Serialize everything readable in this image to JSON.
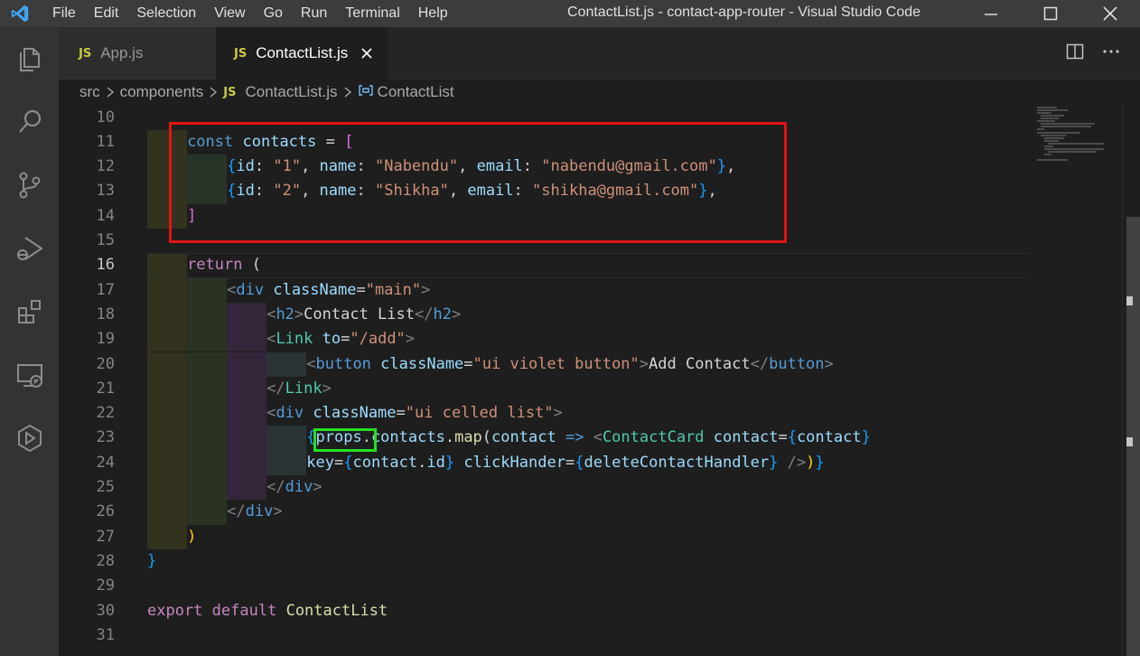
{
  "menu": [
    "File",
    "Edit",
    "Selection",
    "View",
    "Go",
    "Run",
    "Terminal",
    "Help"
  ],
  "window_title": "ContactList.js - contact-app-router - Visual Studio Code",
  "tabs": [
    {
      "badge": "JS",
      "label": "App.js",
      "active": false
    },
    {
      "badge": "JS",
      "label": "ContactList.js",
      "active": true
    }
  ],
  "breadcrumb": {
    "folder1": "src",
    "folder2": "components",
    "file_badge": "JS",
    "file": "ContactList.js",
    "symbol": "ContactList"
  },
  "colors": {
    "annotation_red": "#e11414",
    "annotation_green": "#25e025",
    "editor_bg": "#1e1e1e"
  },
  "editor": {
    "current_line": "16",
    "lines": [
      {
        "n": "10",
        "text": ""
      },
      {
        "n": "11",
        "text": "const contacts = ["
      },
      {
        "n": "12",
        "text": "{id: \"1\", name: \"Nabendu\", email: \"nabendu@gmail.com\"},"
      },
      {
        "n": "13",
        "text": "{id: \"2\", name: \"Shikha\", email: \"shikha@gmail.com\"},"
      },
      {
        "n": "14",
        "text": "]"
      },
      {
        "n": "15",
        "text": ""
      },
      {
        "n": "16",
        "text": "return ("
      },
      {
        "n": "17",
        "text": "<div className=\"main\">"
      },
      {
        "n": "18",
        "text": "<h2>Contact List</h2>"
      },
      {
        "n": "19",
        "text": "<Link to=\"/add\">"
      },
      {
        "n": "20",
        "text": "<button className=\"ui violet button\">Add Contact</button>"
      },
      {
        "n": "21",
        "text": "</Link>"
      },
      {
        "n": "22",
        "text": "<div className=\"ui celled list\">"
      },
      {
        "n": "23",
        "text": "{props.contacts.map(contact => <ContactCard contact={contact}"
      },
      {
        "n": "24",
        "text": "key={contact.id} clickHander={deleteContactHandler} />)}"
      },
      {
        "n": "25",
        "text": "</div>"
      },
      {
        "n": "26",
        "text": "</div>"
      },
      {
        "n": "27",
        "text": ")"
      },
      {
        "n": "28",
        "text": "}"
      },
      {
        "n": "29",
        "text": ""
      },
      {
        "n": "30",
        "text": "export default ContactList"
      },
      {
        "n": "31",
        "text": ""
      }
    ]
  },
  "icons": {
    "activity": [
      "explorer-icon",
      "search-icon",
      "source-control-icon",
      "run-debug-icon",
      "extensions-icon",
      "remote-explorer-icon",
      "live-share-icon"
    ],
    "titlebar": [
      "vscode-logo-icon",
      "minimize-icon",
      "maximize-icon",
      "close-window-icon"
    ],
    "editor_actions": [
      "split-editor-icon",
      "more-actions-icon"
    ]
  }
}
